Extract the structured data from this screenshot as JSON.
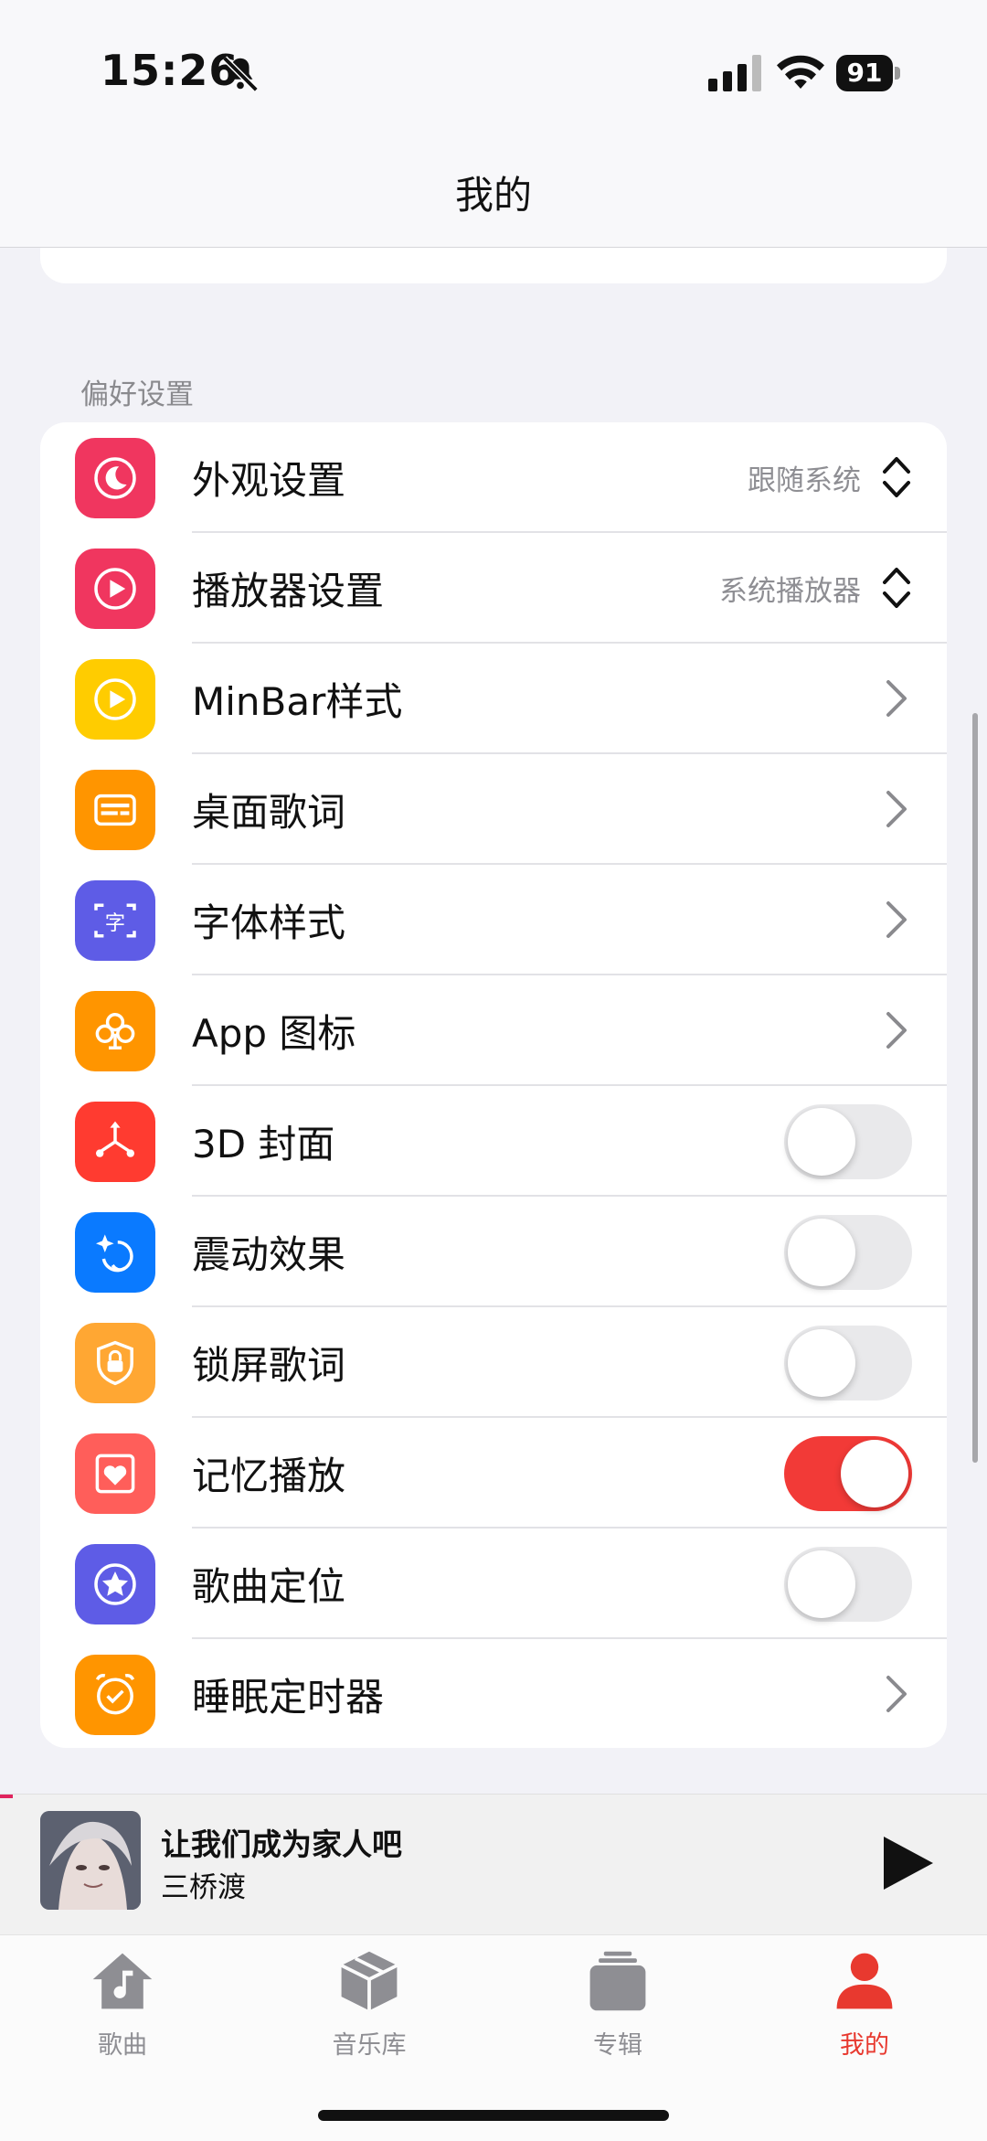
{
  "status": {
    "time": "15:26",
    "battery": "91"
  },
  "nav": {
    "title": "我的"
  },
  "section": {
    "title": "偏好设置"
  },
  "settings": [
    {
      "label": "外观设置",
      "value": "跟随系统",
      "control": "updown",
      "icon": "moon-icon",
      "color": "#f0365f"
    },
    {
      "label": "播放器设置",
      "value": "系统播放器",
      "control": "updown",
      "icon": "play-circle-icon",
      "color": "#f0365f"
    },
    {
      "label": "MinBar样式",
      "control": "chevron",
      "icon": "play-circle-icon",
      "color": "#ffcc00"
    },
    {
      "label": "桌面歌词",
      "control": "chevron",
      "icon": "card-icon",
      "color": "#ff9500"
    },
    {
      "label": "字体样式",
      "control": "chevron",
      "icon": "font-icon",
      "color": "#5e5ce6"
    },
    {
      "label": "App 图标",
      "control": "chevron",
      "icon": "club-icon",
      "color": "#ff9500"
    },
    {
      "label": "3D 封面",
      "control": "toggle",
      "on": false,
      "icon": "3d-icon",
      "color": "#ff3b30"
    },
    {
      "label": "震动效果",
      "control": "toggle",
      "on": false,
      "icon": "sparkle-icon",
      "color": "#0a7aff"
    },
    {
      "label": "锁屏歌词",
      "control": "toggle",
      "on": false,
      "icon": "lock-shield-icon",
      "color": "#ffa733"
    },
    {
      "label": "记忆播放",
      "control": "toggle",
      "on": true,
      "icon": "heart-icon",
      "color": "#ff5e5a"
    },
    {
      "label": "歌曲定位",
      "control": "toggle",
      "on": false,
      "icon": "star-icon",
      "color": "#5e5ce6"
    },
    {
      "label": "睡眠定时器",
      "control": "chevron",
      "icon": "timer-icon",
      "color": "#ff9500"
    }
  ],
  "player": {
    "title": "让我们成为家人吧",
    "artist": "三桥渡"
  },
  "tabs": [
    {
      "label": "歌曲",
      "icon": "home-music-icon",
      "active": false
    },
    {
      "label": "音乐库",
      "icon": "box-icon",
      "active": false
    },
    {
      "label": "专辑",
      "icon": "album-stack-icon",
      "active": false
    },
    {
      "label": "我的",
      "icon": "person-icon",
      "active": true
    }
  ],
  "colors": {
    "accent": "#e8392f",
    "toggle_on": "#f23a37"
  }
}
